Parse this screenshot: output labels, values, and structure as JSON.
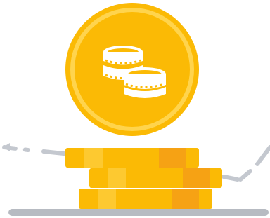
{
  "illustration": {
    "subject": "coin-stack-illustration",
    "icons": {
      "big_coin": "coins-icon",
      "stack": "gold-bars-stack"
    },
    "colors": {
      "coin_gold": "#FBBA05",
      "coin_ring": "#FFD44D",
      "coin_shadow": "#F6A214",
      "icon_white": "#FFFFFF",
      "dash_gray": "#C4C8CF",
      "ground_gray": "#B7BBC2"
    }
  }
}
